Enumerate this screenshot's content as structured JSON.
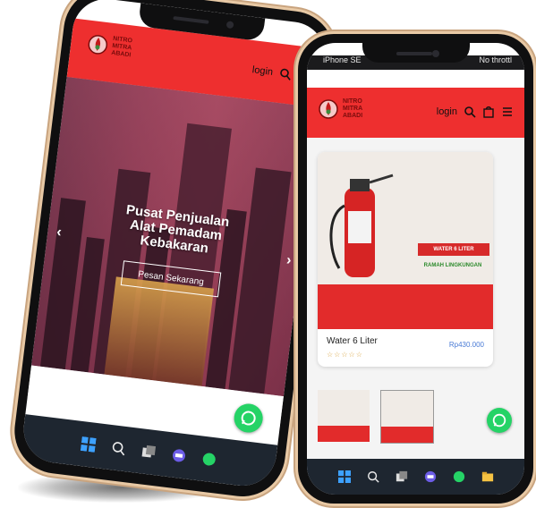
{
  "phone_left": {
    "header": {
      "logo_line1": "NITRO",
      "logo_line2": "MITRA",
      "logo_line3": "ABADI",
      "login": "login"
    },
    "hero": {
      "title_line1": "Pusat Penjualan",
      "title_line2": "Alat Pemadam",
      "title_line3": "Kebakaran",
      "button": "Pesan Sekarang"
    }
  },
  "phone_right": {
    "status": {
      "device": "iPhone SE",
      "throttle": "No throttl"
    },
    "header": {
      "logo_line1": "NITRO",
      "logo_line2": "MITRA",
      "logo_line3": "ABADI",
      "login": "login"
    },
    "product": {
      "tag_label": "WATER 6 LITER",
      "eco_label": "RAMAH LINGKUNGAN",
      "name": "Water 6 Liter",
      "price": "Rp430.000",
      "stars": "☆☆☆☆☆"
    }
  },
  "colors": {
    "brand_red": "#ee2f2f",
    "price_blue": "#4a7bd6",
    "whatsapp_green": "#25d366"
  },
  "icons": [
    "search-icon",
    "cart-icon",
    "menu-icon",
    "whatsapp-icon",
    "windows-icon"
  ]
}
